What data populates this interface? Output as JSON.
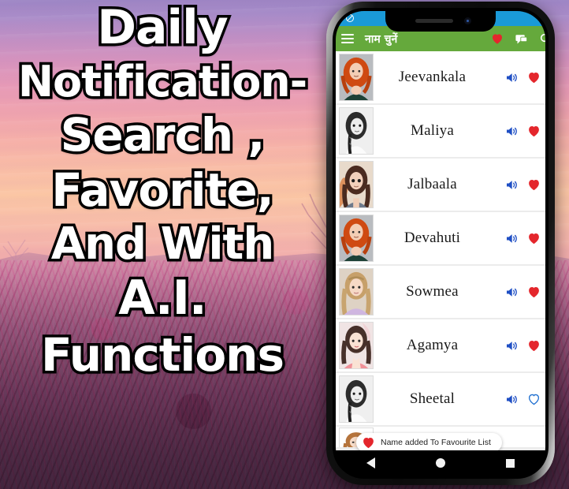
{
  "promo": {
    "lines": [
      "Daily",
      "Notification-",
      "Search ,",
      "Favorite,",
      "And With",
      "A.I.",
      "Functions"
    ]
  },
  "phone": {
    "statusbar": {
      "icon": "mute-icon"
    },
    "appbar": {
      "menu_icon": "hamburger-menu-icon",
      "title": "नाम चुनें",
      "actions": [
        {
          "icon": "heart-icon",
          "color": "#e4262c"
        },
        {
          "icon": "chat-icon",
          "color": "#ffffff"
        },
        {
          "icon": "search-icon",
          "color": "#ffffff"
        }
      ]
    },
    "list": {
      "rows": [
        {
          "name": "Jeevankala",
          "avatar": "red-curly-hair-girl",
          "speaker_icon": "speaker-icon",
          "favorite_icon": "heart-filled-icon",
          "favorited": true
        },
        {
          "name": "Maliya",
          "avatar": "grayscale-braid-girl",
          "speaker_icon": "speaker-icon",
          "favorite_icon": "heart-filled-icon",
          "favorited": true
        },
        {
          "name": "Jalbaala",
          "avatar": "brown-long-hair-girl",
          "speaker_icon": "speaker-icon",
          "favorite_icon": "heart-filled-icon",
          "favorited": true
        },
        {
          "name": "Devahuti",
          "avatar": "red-curly-hair-girl",
          "speaker_icon": "speaker-icon",
          "favorite_icon": "heart-filled-icon",
          "favorited": true
        },
        {
          "name": "Sowmea",
          "avatar": "blonde-wavy-hair-girl",
          "speaker_icon": "speaker-icon",
          "favorite_icon": "heart-filled-icon",
          "favorited": true
        },
        {
          "name": "Agamya",
          "avatar": "dark-hair-pink-top-girl",
          "speaker_icon": "speaker-icon",
          "favorite_icon": "heart-filled-icon",
          "favorited": true
        },
        {
          "name": "Sheetal",
          "avatar": "grayscale-braid-girl",
          "speaker_icon": "speaker-icon",
          "favorite_icon": "heart-outline-icon",
          "favorited": false
        },
        {
          "name": "",
          "avatar": "auburn-hair-girl",
          "speaker_icon": "",
          "favorite_icon": "",
          "favorited": false
        }
      ]
    },
    "toast": {
      "icon": "heart-icon",
      "message": "Name added To Favourite List"
    },
    "navbar": {
      "back": "back-triangle-icon",
      "home": "home-circle-icon",
      "recents": "recents-square-icon"
    }
  },
  "colors": {
    "appbar_green": "#65a93c",
    "statusbar_blue": "#1a9ad8",
    "heart_red": "#e4262c",
    "speaker_blue": "#1f4fc4",
    "heart_outline_blue": "#1f6fd0",
    "list_bg": "#ececec",
    "row_bg": "#ffffff"
  }
}
